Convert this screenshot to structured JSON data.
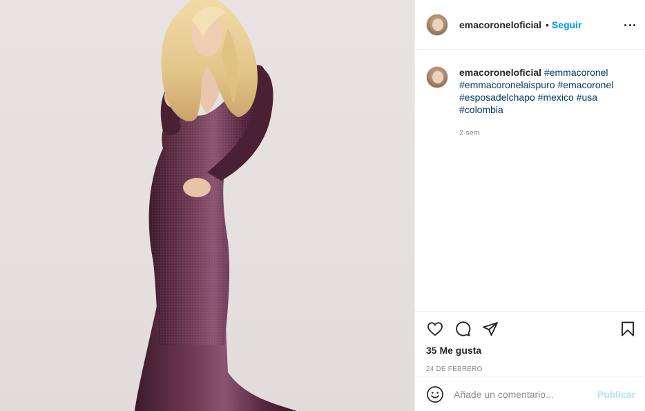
{
  "post": {
    "username": "emacoroneloficial",
    "separator": "•",
    "follow_label": "Seguir"
  },
  "caption": {
    "username": "emacoroneloficial",
    "hashtags": [
      "#emmacoronel",
      "#emmacoronelaispuro",
      "#emacoronel",
      "#esposadelchapo",
      "#mexico",
      "#usa",
      "#colombia"
    ],
    "time": "2 sem"
  },
  "actions": {
    "icons": [
      "heart-icon",
      "comment-icon",
      "share-icon",
      "bookmark-icon"
    ]
  },
  "likes_text": "35 Me gusta",
  "date_text": "24 DE FEBRERO",
  "comment": {
    "placeholder": "Añade un comentario...",
    "post_label": "Publicar"
  },
  "colors": {
    "link": "#0095f6",
    "hashtag": "#00376b",
    "post_disabled": "#b2dffc",
    "dress": "#5a2a3f"
  }
}
